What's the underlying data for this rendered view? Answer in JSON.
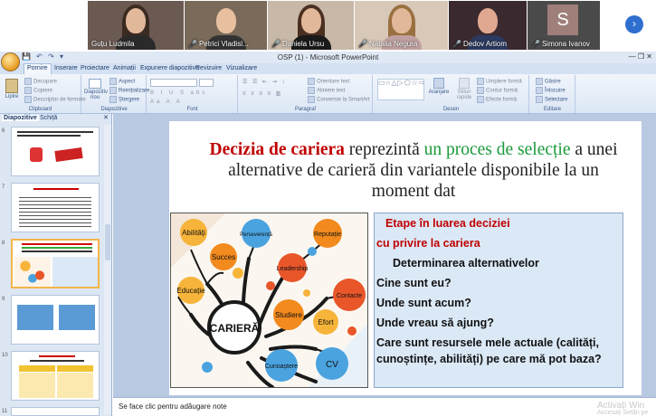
{
  "meeting": {
    "participants": [
      {
        "name": "Guțu Ludmila",
        "muted": false
      },
      {
        "name": "Petrici Vladisl...",
        "muted": true
      },
      {
        "name": "Daniela Ursu",
        "muted": true
      },
      {
        "name": "Natalia Negura",
        "muted": true
      },
      {
        "name": "Dedov Artiom",
        "muted": true
      },
      {
        "name": "Simona Ivanov",
        "muted": true
      }
    ],
    "avatar_letter": "S",
    "next_icon": "›"
  },
  "window": {
    "title": "OSP (1) - Microsoft PowerPoint",
    "qat": "💾 ↶ ↷ ▾",
    "controls": "—  ❐  ✕"
  },
  "ribbon": {
    "tabs": [
      "Pornire",
      "Inserare",
      "Proiectare",
      "Animații",
      "Expunere diapozitive",
      "Revizuire",
      "Vizualizare"
    ],
    "active_tab": "Pornire",
    "groups": {
      "clipboard": {
        "name": "Clipboard",
        "paste": "Lipire",
        "cut": "Decupare",
        "copy": "Copiere",
        "format_painter": "Descriptor de formate"
      },
      "slides": {
        "name": "Diapozitive",
        "new_slide": "Diapozitiv nou",
        "layout": "Aspect",
        "reset": "Reinițializare",
        "delete": "Ștergere"
      },
      "font": {
        "name": "Font"
      },
      "paragraph": {
        "name": "Paragraf",
        "text_direction": "Orientare text",
        "align_text": "Aliniere text",
        "smartart": "Conversie la SmartArt"
      },
      "drawing": {
        "name": "Desen",
        "arrange": "Aranjare",
        "quick_styles": "Stiluri rapide",
        "shape_fill": "Umplere formă",
        "shape_outline": "Contur formă",
        "shape_effects": "Efecte formă"
      },
      "editing": {
        "name": "Editare",
        "find": "Găsire",
        "replace": "Înlocuire",
        "select": "Selectare"
      }
    }
  },
  "left_panel": {
    "tabs": [
      "Diapozitive",
      "Schiță"
    ],
    "close": "✕",
    "slide_numbers": [
      "6",
      "7",
      "8",
      "9",
      "10",
      "11"
    ],
    "selected_index": 2
  },
  "slide": {
    "title_part1": "Decizia de cariera",
    "title_part2": " reprezintă ",
    "title_part3": "un proces de selecție",
    "title_part4": " a unei alternative de  carieră din variantele disponibile la un moment dat",
    "mindmap": {
      "center": "CARIERĂ",
      "nodes": [
        "Abilități",
        "Succes",
        "Educație",
        "Perseverență",
        "Reputație",
        "Leadership",
        "Contacte",
        "Studiere",
        "Efort",
        "Cunoaștere",
        "CV"
      ]
    },
    "textbox": {
      "heading1": "Etape în luarea deciziei",
      "heading2": "cu privire la cariera",
      "line1": "Determinarea alternativelor",
      "line2": "Cine sunt eu?",
      "line3": "Unde sunt acum?",
      "line4": "Unde vreau să ajung?",
      "line5": "Care sunt resursele mele actuale (calități,",
      "line6": "cunoștințe, abilități) pe care mă pot baza?"
    }
  },
  "notes": {
    "placeholder": "Se face clic pentru adăugare note",
    "watermark_title": "Activați Win",
    "watermark_sub": "Accesați Setări pe"
  },
  "colors": {
    "accent_red": "#c00000",
    "accent_green": "#1a9a3a",
    "selection_orange": "#f3b54a",
    "ribbon_blue": "#d4e1f3"
  }
}
